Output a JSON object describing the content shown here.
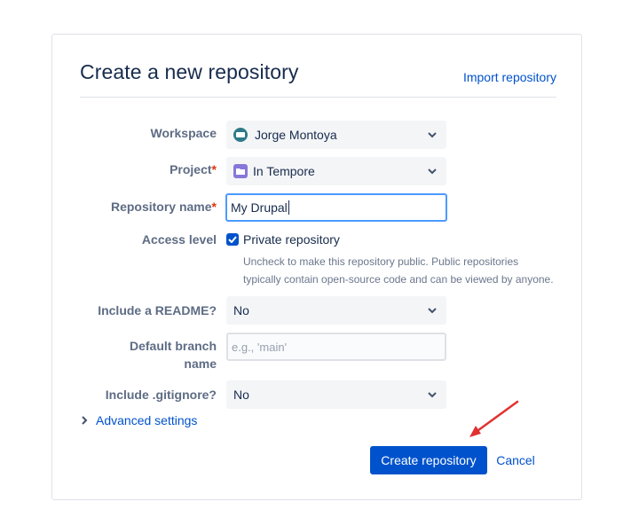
{
  "header": {
    "title": "Create a new repository",
    "import_link": "Import repository"
  },
  "form": {
    "workspace": {
      "label": "Workspace",
      "value": "Jorge Montoya",
      "icon": "workspace-avatar-icon"
    },
    "project": {
      "label": "Project",
      "required_mark": "*",
      "value": "In Tempore",
      "icon": "project-folder-icon"
    },
    "repository_name": {
      "label": "Repository name",
      "required_mark": "*",
      "value": "My Drupal"
    },
    "access_level": {
      "label": "Access level",
      "checkbox_label": "Private repository",
      "checked": true,
      "help_line1": "Uncheck to make this repository public. Public repositories",
      "help_line2": "typically contain open-source code and can be viewed by anyone."
    },
    "readme": {
      "label": "Include a README?",
      "value": "No"
    },
    "default_branch": {
      "label_line1": "Default branch",
      "label_line2": "name",
      "placeholder": "e.g., 'main'"
    },
    "gitignore": {
      "label": "Include .gitignore?",
      "value": "No"
    },
    "advanced_settings": "Advanced settings"
  },
  "actions": {
    "create_label": "Create repository",
    "cancel_label": "Cancel"
  },
  "colors": {
    "primary": "#0052cc",
    "required": "#de350b",
    "annotation_arrow": "#e03131"
  }
}
